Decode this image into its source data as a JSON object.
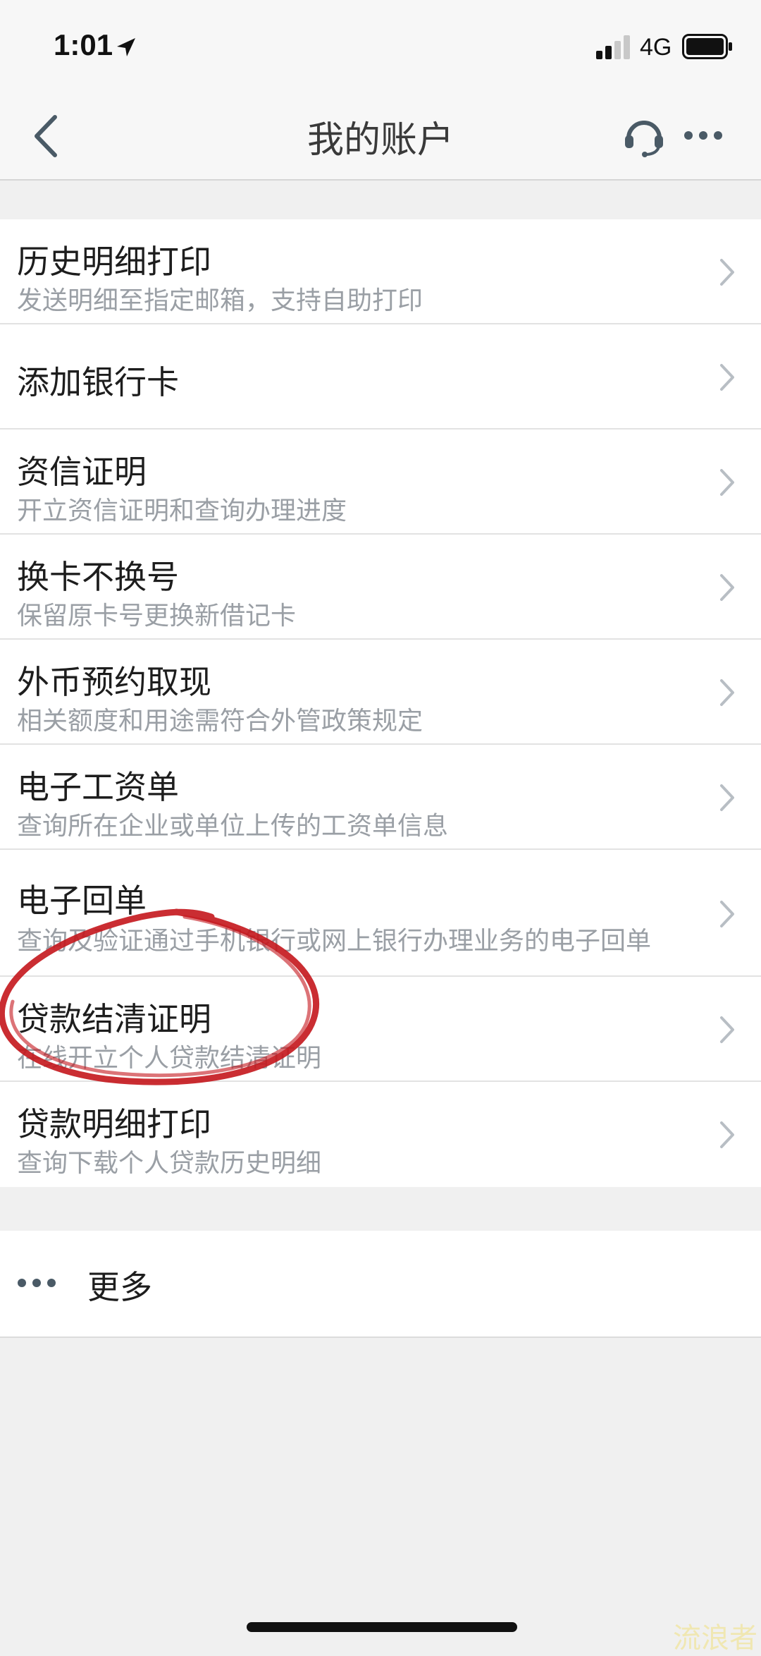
{
  "status_bar": {
    "time": "1:01",
    "network": "4G"
  },
  "nav": {
    "title": "我的账户",
    "back_icon": "chevron-left-icon",
    "service_icon": "headset-icon",
    "more_icon": "more-horizontal-icon"
  },
  "menu": {
    "items": [
      {
        "title": "历史明细打印",
        "subtitle": "发送明细至指定邮箱，支持自助打印"
      },
      {
        "title": "添加银行卡",
        "subtitle": ""
      },
      {
        "title": "资信证明",
        "subtitle": "开立资信证明和查询办理进度"
      },
      {
        "title": "换卡不换号",
        "subtitle": "保留原卡号更换新借记卡"
      },
      {
        "title": "外币预约取现",
        "subtitle": "相关额度和用途需符合外管政策规定"
      },
      {
        "title": "电子工资单",
        "subtitle": "查询所在企业或单位上传的工资单信息"
      },
      {
        "title": "电子回单",
        "subtitle": "查询及验证通过手机银行或网上银行办理业务的电子回单"
      },
      {
        "title": "贷款结清证明",
        "subtitle": "在线开立个人贷款结清证明"
      },
      {
        "title": "贷款明细打印",
        "subtitle": "查询下载个人贷款历史明细"
      }
    ]
  },
  "more": {
    "label": "更多"
  },
  "watermark": "流浪者",
  "colors": {
    "annotation_circle": "#c4161c",
    "background": "#f0f0f0",
    "subtitle": "#9a9fa5"
  }
}
